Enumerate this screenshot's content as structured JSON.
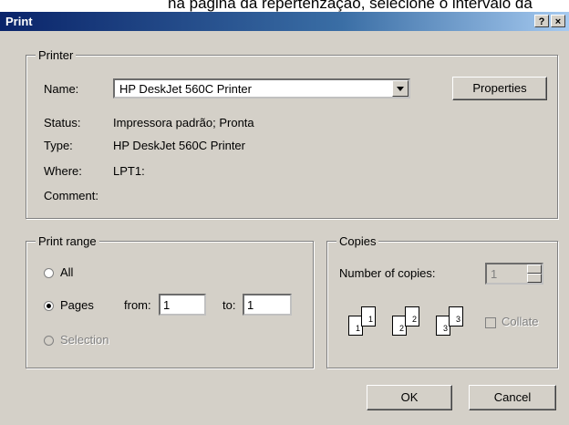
{
  "background_caption": "na página da repertenzação, selecione o intervalo da",
  "window": {
    "title": "Print",
    "help_button": "?",
    "close_button": "×"
  },
  "printer": {
    "legend": "Printer",
    "name_label": "Name:",
    "name_value": "HP DeskJet 560C Printer",
    "properties_button": "Properties",
    "status_label": "Status:",
    "status_value": "Impressora padrão; Pronta",
    "type_label": "Type:",
    "type_value": "HP DeskJet 560C Printer",
    "where_label": "Where:",
    "where_value": "LPT1:",
    "comment_label": "Comment:",
    "comment_value": ""
  },
  "print_range": {
    "legend": "Print range",
    "all_label": "All",
    "pages_label": "Pages",
    "from_label": "from:",
    "from_value": "1",
    "to_label": "to:",
    "to_value": "1",
    "selection_label": "Selection",
    "selected": "pages"
  },
  "copies": {
    "legend": "Copies",
    "number_label": "Number of copies:",
    "number_value": "1",
    "collate_label": "Collate",
    "collate_checked": false,
    "collate_icons": [
      [
        "1",
        "1"
      ],
      [
        "2",
        "2"
      ],
      [
        "3",
        "3"
      ]
    ]
  },
  "buttons": {
    "ok": "OK",
    "cancel": "Cancel"
  },
  "colors": {
    "face": "#d4d0c8",
    "title_start": "#0a246a",
    "title_end": "#a6caf0"
  }
}
